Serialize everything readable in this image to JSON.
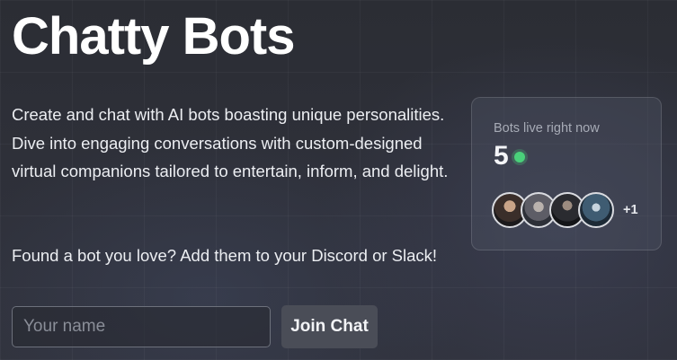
{
  "hero": {
    "title": "Chatty Bots",
    "intro": "Create and chat with AI bots boasting unique personalities. Dive into engaging conversations with custom-designed virtual companions tailored to entertain, inform, and delight.",
    "cta_text": "Found a bot you love? Add them to your Discord or Slack!"
  },
  "join_form": {
    "name_placeholder": "Your name",
    "name_value": "",
    "join_label": "Join Chat"
  },
  "live_panel": {
    "label": "Bots live right now",
    "count": "5",
    "status_color": "#4ad07a",
    "avatars": [
      {
        "name": "bot-avatar-1"
      },
      {
        "name": "bot-avatar-2"
      },
      {
        "name": "bot-avatar-3"
      },
      {
        "name": "bot-avatar-4"
      }
    ],
    "more_count": "+1"
  },
  "colors": {
    "background": "#2e3039",
    "button": "#4a4d57",
    "live_status": "#4ad07a"
  }
}
